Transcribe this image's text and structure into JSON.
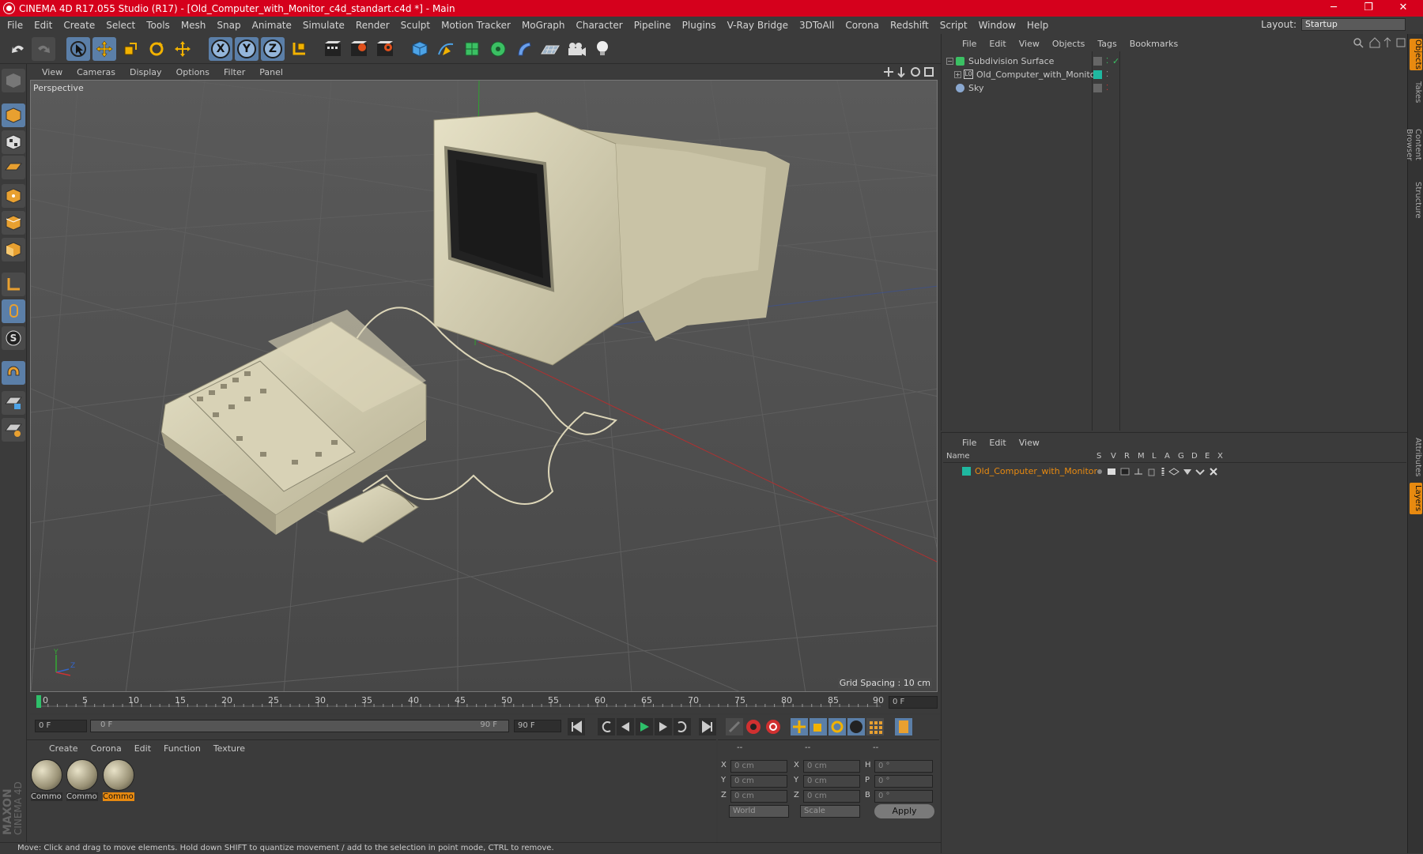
{
  "window": {
    "title": "CINEMA 4D R17.055 Studio (R17) - [Old_Computer_with_Monitor_c4d_standart.c4d *] - Main",
    "minimize": "─",
    "maximize": "❐",
    "close": "✕"
  },
  "menubar": {
    "items": [
      "File",
      "Edit",
      "Create",
      "Select",
      "Tools",
      "Mesh",
      "Snap",
      "Animate",
      "Simulate",
      "Render",
      "Sculpt",
      "Motion Tracker",
      "MoGraph",
      "Character",
      "Pipeline",
      "Plugins",
      "V-Ray Bridge",
      "3DToAll",
      "Corona",
      "Redshift",
      "Script",
      "Window",
      "Help"
    ],
    "layout_label": "Layout:",
    "layout_value": "Startup"
  },
  "toolbar": {
    "axis_x": "X",
    "axis_y": "Y",
    "axis_z": "Z"
  },
  "lefttools": {
    "snap_label": "S"
  },
  "viewport": {
    "menu": [
      "View",
      "Cameras",
      "Display",
      "Options",
      "Filter",
      "Panel"
    ],
    "camera_label": "Perspective",
    "grid_spacing": "Grid Spacing : 10 cm",
    "axis_y": "Y",
    "axis_z": "Z"
  },
  "timeline": {
    "ticks": [
      "0",
      "5",
      "10",
      "15",
      "20",
      "25",
      "30",
      "35",
      "40",
      "45",
      "50",
      "55",
      "60",
      "65",
      "70",
      "75",
      "80",
      "85",
      "90"
    ],
    "current_frame": "0 F"
  },
  "transport": {
    "start_frame": "0 F",
    "range_start": "0 F",
    "range_end": "90 F",
    "end_frame": "90 F"
  },
  "materials": {
    "menu": [
      "Create",
      "Corona",
      "Edit",
      "Function",
      "Texture"
    ],
    "items": [
      {
        "label": "Commo"
      },
      {
        "label": "Commo"
      },
      {
        "label": "Commo"
      }
    ]
  },
  "coordinates": {
    "headers": [
      "--",
      "--",
      "--"
    ],
    "pos_x_label": "X",
    "pos_x": "0 cm",
    "pos_y_label": "Y",
    "pos_y": "0 cm",
    "pos_z_label": "Z",
    "pos_z": "0 cm",
    "size_x_label": "X",
    "size_x": "0 cm",
    "size_y_label": "Y",
    "size_y": "0 cm",
    "size_z_label": "Z",
    "size_z": "0 cm",
    "rot_h_label": "H",
    "rot_h": "0 °",
    "rot_p_label": "P",
    "rot_p": "0 °",
    "rot_b_label": "B",
    "rot_b": "0 °",
    "space": "World",
    "mode": "Scale",
    "apply": "Apply"
  },
  "status": {
    "text": "Move: Click and drag to move elements. Hold down SHIFT to quantize movement / add to the selection in point mode, CTRL to remove."
  },
  "objects": {
    "menu": [
      "File",
      "Edit",
      "View",
      "Objects",
      "Tags",
      "Bookmarks"
    ],
    "rows": [
      {
        "name": "Subdivision Surface"
      },
      {
        "name": "Old_Computer_with_Monitor"
      },
      {
        "name": "Sky"
      }
    ]
  },
  "layers": {
    "menu": [
      "File",
      "Edit",
      "View"
    ],
    "col_name": "Name",
    "cols": [
      "S",
      "V",
      "R",
      "M",
      "L",
      "A",
      "G",
      "D",
      "E",
      "X"
    ],
    "rows": [
      {
        "name": "Old_Computer_with_Monitor",
        "color": "#1fb8a0"
      }
    ]
  },
  "right_tabs": [
    "Objects",
    "Takes",
    "Content Browser",
    "Structure",
    "Attributes",
    "Layers"
  ],
  "brand": {
    "maxon": "MAXON",
    "product": "CINEMA 4D"
  },
  "colors": {
    "titlebar": "#d5001c",
    "selection_orange": "#e88a10",
    "tool_blue": "#5b7fa8"
  }
}
